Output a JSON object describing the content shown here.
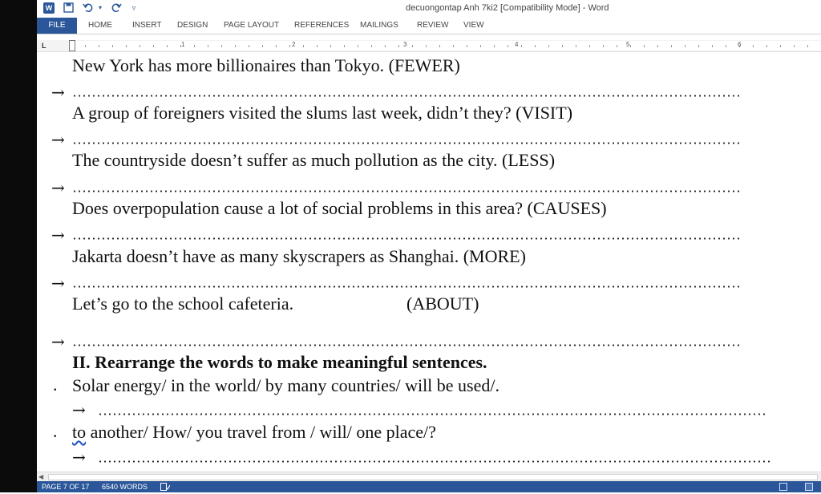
{
  "window": {
    "title": "decuongontap Anh 7ki2 [Compatibility Mode] - Word",
    "quick_access": [
      "save-icon",
      "undo-icon",
      "redo-icon",
      "customize-icon"
    ]
  },
  "ribbon": {
    "tabs": [
      {
        "label": "FILE",
        "active": true
      },
      {
        "label": "HOME"
      },
      {
        "label": "INSERT"
      },
      {
        "label": "DESIGN"
      },
      {
        "label": "PAGE LAYOUT"
      },
      {
        "label": "REFERENCES"
      },
      {
        "label": "MAILINGS"
      },
      {
        "label": "REVIEW"
      },
      {
        "label": "VIEW"
      }
    ]
  },
  "ruler": {
    "tab_selector": "L",
    "numbers": [
      "1",
      "2",
      "3",
      "4",
      "5",
      "6"
    ]
  },
  "document": {
    "arrow": "→",
    "bullet": ".",
    "exercises": [
      "New York has more billionaires than Tokyo. (FEWER)",
      "A group of foreigners visited the slums last week, didn’t they? (VISIT)",
      "The countryside doesn’t suffer as much pollution as the city. (LESS)",
      "Does overpopulation cause a lot of social problems in this area?  (CAUSES)",
      "Jakarta doesn’t have as many skyscrapers as Shanghai. (MORE)"
    ],
    "cafeteria_sentence": "Let’s go to the school cafeteria.",
    "cafeteria_keyword": "(ABOUT)",
    "section_heading": "II. Rearrange the words to make meaningful sentences.",
    "rearrange_1": "Solar energy/ in the world/ by many countries/ will be used/.",
    "rearrange_2_first": "to",
    "rearrange_2_rest": " another/ How/ you travel from / will/ one place/?"
  },
  "statusbar": {
    "page": "PAGE 7 OF 17",
    "words": "6540 WORDS",
    "proofing_icon": "proofing-icon"
  },
  "colors": {
    "accent": "#2b579a",
    "left_bar": "#0b0b0b"
  }
}
